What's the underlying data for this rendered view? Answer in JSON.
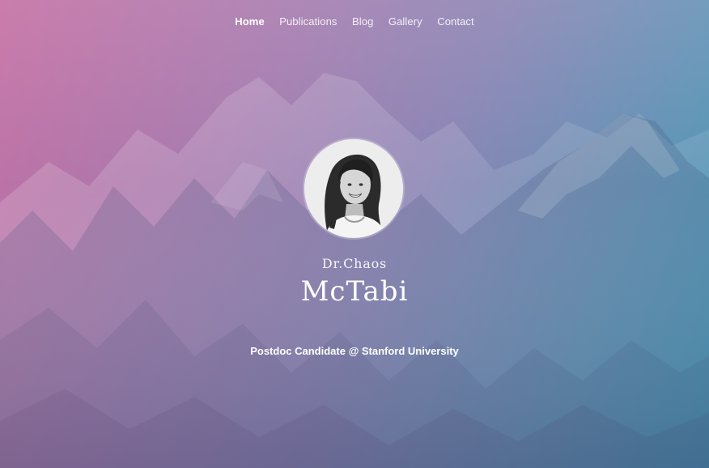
{
  "nav": {
    "items": [
      {
        "label": "Home",
        "active": true
      },
      {
        "label": "Publications",
        "active": false
      },
      {
        "label": "Blog",
        "active": false
      },
      {
        "label": "Gallery",
        "active": false
      },
      {
        "label": "Contact",
        "active": false
      }
    ]
  },
  "profile": {
    "title_first": "Dr.Chaos",
    "title_last": "McTabi",
    "tagline": "Postdoc Candidate @ Stanford University",
    "avatar_icon": "profile-photo"
  },
  "colors": {
    "gradient_left": "#c46fa3",
    "gradient_mid": "#8a84b4",
    "gradient_right": "#3f97b6",
    "text": "#ffffff"
  }
}
